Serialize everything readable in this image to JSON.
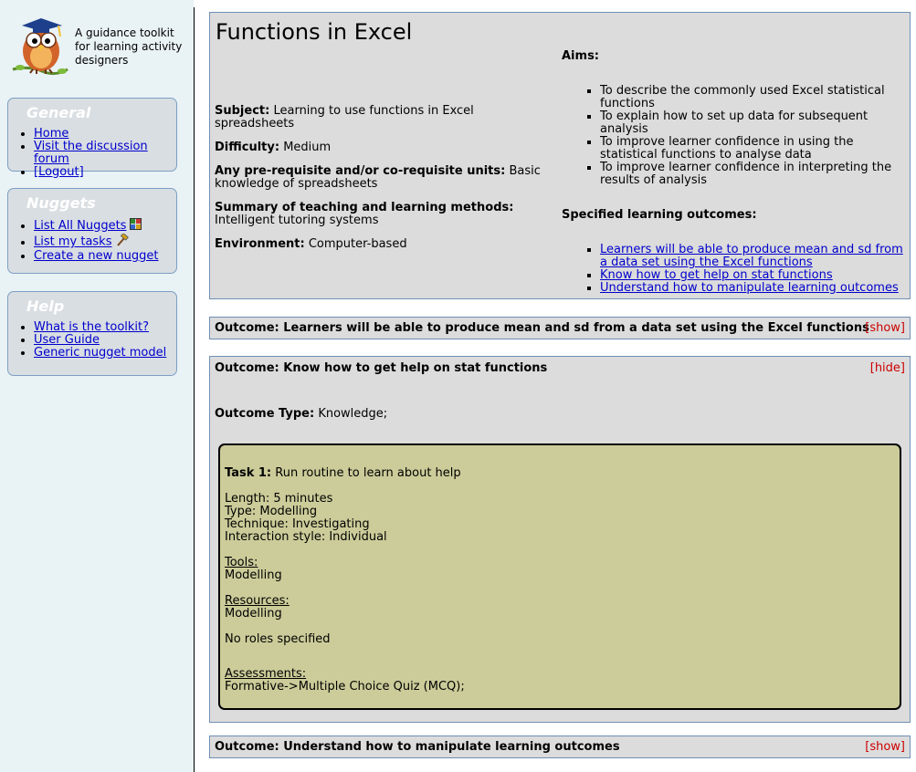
{
  "sidebar": {
    "logo_text": "A guidance toolkit for learning activity designers",
    "general": {
      "title": "General",
      "items": [
        "Home",
        "Visit the discussion forum",
        "[Logout]"
      ]
    },
    "nuggets": {
      "title": "Nuggets",
      "items": [
        "List All Nuggets",
        "List my tasks",
        "Create a new nugget"
      ]
    },
    "help": {
      "title": "Help",
      "items": [
        "What is the toolkit?",
        "User Guide",
        "Generic nugget model"
      ]
    }
  },
  "main": {
    "title": "Functions in Excel",
    "fields": [
      {
        "label": "Subject:",
        "value": "Learning to use functions in Excel spreadsheets"
      },
      {
        "label": "Difficulty:",
        "value": "Medium"
      },
      {
        "label": "Any pre-requisite and/or co-requisite units:",
        "value": "Basic knowledge of spreadsheets"
      },
      {
        "label": "Summary of teaching and learning methods:",
        "value": "Intelligent tutoring systems"
      },
      {
        "label": "Environment:",
        "value": "Computer-based"
      }
    ],
    "aims_heading": "Aims:",
    "aims": [
      "To describe the commonly used Excel statistical functions",
      "To explain how to set up data for subsequent analysis",
      "To improve learner confidence in using the statistical functions to analyse data",
      "To improve learner confidence in interpreting the results of analysis"
    ],
    "outcomes_heading": "Specified learning outcomes:",
    "outcome_links": [
      "Learners will be able to produce mean and sd from a data set using the Excel functions",
      "Know how to get help on stat functions",
      "Understand how to manipulate learning outcomes"
    ]
  },
  "outcomes": [
    {
      "title": "Outcome: Learners will be able to produce mean and sd from a data set using the Excel functions",
      "toggle": "[show]"
    },
    {
      "title": "Outcome: Know how to get help on stat functions",
      "toggle": "[hide]",
      "type_label": "Outcome Type:",
      "type_value": "Knowledge;",
      "task": {
        "label": "Task 1:",
        "name": "Run routine to learn about help",
        "length": "Length: 5 minutes",
        "type": "Type: Modelling",
        "technique": "Technique: Investigating",
        "interaction": "Interaction style: Individual",
        "tools_label": "Tools:",
        "tools_value": "Modelling",
        "resources_label": "Resources:",
        "resources_value": "Modelling",
        "roles": "No roles specified",
        "assessments_label": "Assessments:",
        "assessments_value": "Formative->Multiple Choice Quiz (MCQ);"
      }
    },
    {
      "title": "Outcome: Understand how to manipulate learning outcomes",
      "toggle": "[show]"
    }
  ],
  "colors": {
    "sidebar_bg": "#e9f2f5",
    "panel_bg": "#dcdcdc",
    "panel_border": "#6f8fb5",
    "task_bg": "#cccc9a",
    "link": "#0000cc",
    "toggle": "#cc0000"
  }
}
